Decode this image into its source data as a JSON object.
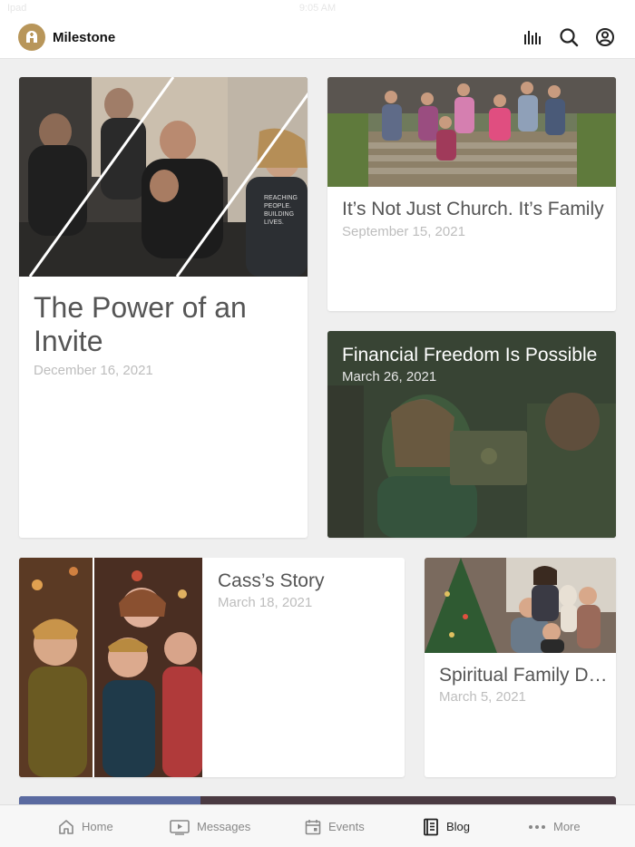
{
  "status": {
    "carrier": "Ipad",
    "time": "9:05 AM"
  },
  "header": {
    "app_name": "Milestone",
    "icons": [
      "audio-bars-icon",
      "search-icon",
      "account-icon"
    ],
    "logo_color": "#b8965a"
  },
  "posts": [
    {
      "title": "The Power of an Invite",
      "date": "December 16, 2021"
    },
    {
      "title": "It’s Not Just Church. It’s Family",
      "date": "September 15, 2021"
    },
    {
      "title": "Financial Freedom Is Possible",
      "date": "March 26, 2021"
    },
    {
      "title": "Cass’s Story",
      "date": "March 18, 2021"
    },
    {
      "title": "Spiritual Family Dynamics",
      "date": "March 5, 2021"
    }
  ],
  "tabbar": {
    "tabs": [
      {
        "label": "Home",
        "icon": "home-icon"
      },
      {
        "label": "Messages",
        "icon": "play-screen-icon"
      },
      {
        "label": "Events",
        "icon": "calendar-icon"
      },
      {
        "label": "Blog",
        "icon": "book-icon"
      },
      {
        "label": "More",
        "icon": "ellipsis-icon"
      }
    ],
    "active": "Blog"
  }
}
